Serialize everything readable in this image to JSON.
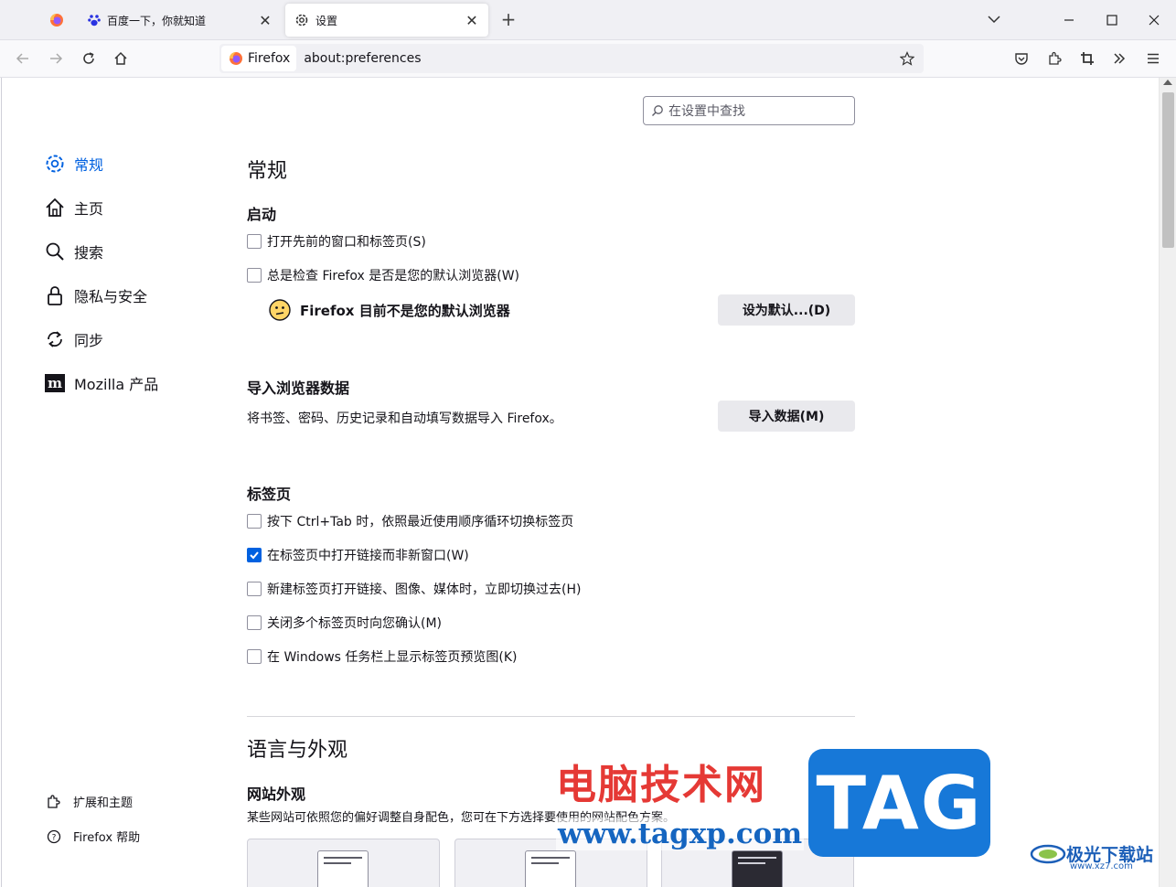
{
  "window": {
    "tabs": [
      {
        "title": ""
      },
      {
        "title": "百度一下，你就知道"
      },
      {
        "title": "设置"
      }
    ]
  },
  "navbar": {
    "identity_label": "Firefox",
    "url": "about:preferences"
  },
  "search": {
    "placeholder": "在设置中查找"
  },
  "sidebar": {
    "categories": [
      {
        "label": "常规",
        "icon": "gear-icon"
      },
      {
        "label": "主页",
        "icon": "home-icon"
      },
      {
        "label": "搜索",
        "icon": "search-icon"
      },
      {
        "label": "隐私与安全",
        "icon": "lock-icon"
      },
      {
        "label": "同步",
        "icon": "sync-icon"
      },
      {
        "label": "Mozilla 产品",
        "icon": "mozilla-icon"
      }
    ],
    "footer": [
      {
        "label": "扩展和主题",
        "icon": "extensions-icon"
      },
      {
        "label": "Firefox 帮助",
        "icon": "help-icon"
      }
    ]
  },
  "general": {
    "heading": "常规",
    "startup": {
      "heading": "启动",
      "restore_session": "打开先前的窗口和标签页(S)",
      "check_default": "总是检查 Firefox 是否是您的默认浏览器(W)",
      "default_status": "Firefox 目前不是您的默认浏览器",
      "set_default_button": "设为默认...(D)"
    },
    "import": {
      "heading": "导入浏览器数据",
      "description": "将书签、密码、历史记录和自动填写数据导入 Firefox。",
      "button": "导入数据(M)"
    },
    "tabs": {
      "heading": "标签页",
      "options": [
        {
          "label": "按下 Ctrl+Tab 时，依照最近使用顺序循环切换标签页",
          "checked": false
        },
        {
          "label": "在标签页中打开链接而非新窗口(W)",
          "checked": true
        },
        {
          "label": "新建标签页打开链接、图像、媒体时，立即切换过去(H)",
          "checked": false
        },
        {
          "label": "关闭多个标签页时向您确认(M)",
          "checked": false
        },
        {
          "label": "在 Windows 任务栏上显示标签页预览图(K)",
          "checked": false
        }
      ]
    }
  },
  "language": {
    "heading": "语言与外观",
    "website_appearance": {
      "heading": "网站外观",
      "description": "某些网站可依照您的偏好调整自身配色，您可在下方选择要使用的网站配色方案。"
    }
  },
  "watermarks": {
    "cn_text": "电脑技术网",
    "url_text": "www.tagxp.com",
    "tag_text": "TAG",
    "jg_text": "极光下载站",
    "jg_sub": "www.xz7.com"
  },
  "colors": {
    "accent": "#0061e0",
    "checkbox_checked": "#0061e0"
  }
}
